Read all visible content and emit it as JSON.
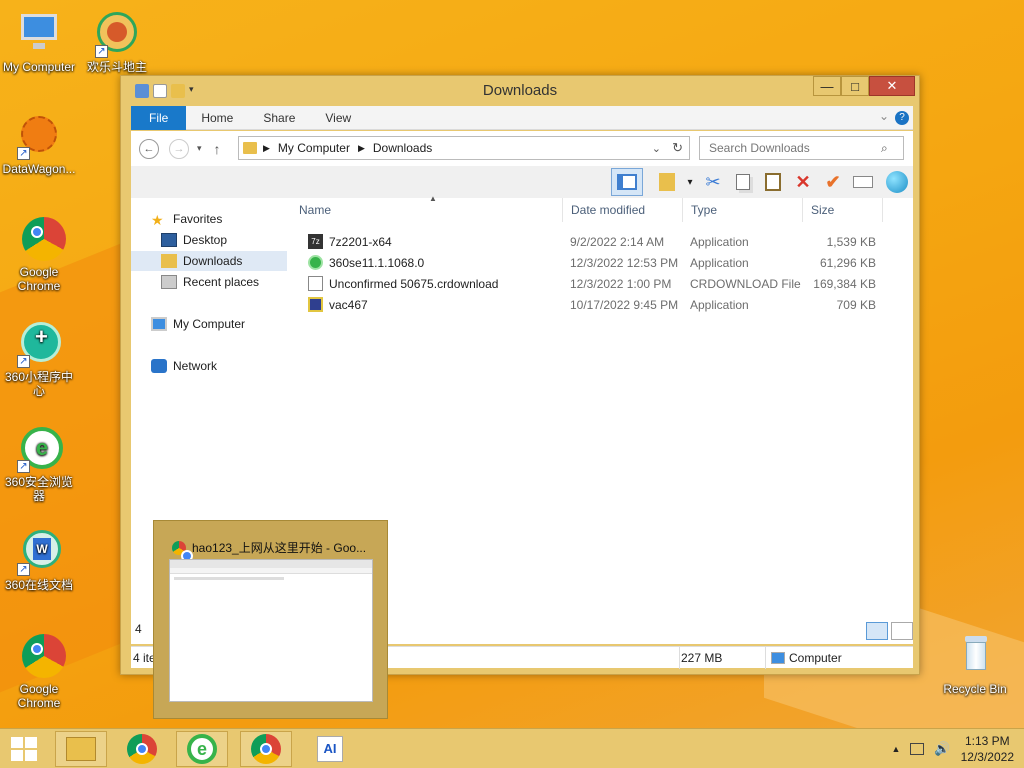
{
  "desktop": {
    "icons": [
      {
        "label": "My Computer"
      },
      {
        "label": "欢乐斗地主"
      },
      {
        "label": "DataWagon..."
      },
      {
        "label": "Google Chrome"
      },
      {
        "label": "360小程序中心"
      },
      {
        "label": "360安全浏览器"
      },
      {
        "label": "360在线文档"
      },
      {
        "label": "Google Chrome"
      },
      {
        "label": "Recycle Bin"
      }
    ]
  },
  "window": {
    "title": "Downloads",
    "controls": {
      "minimize": "—",
      "maximize": "□",
      "close": "✕"
    },
    "ribbon": {
      "tabs": [
        "File",
        "Home",
        "Share",
        "View"
      ],
      "help": "?"
    },
    "address": {
      "path": [
        "My Computer",
        "Downloads"
      ]
    },
    "search": {
      "placeholder": "Search Downloads"
    },
    "nav": {
      "favorites": "Favorites",
      "desktop": "Desktop",
      "downloads": "Downloads",
      "recent": "Recent places",
      "computer": "My Computer",
      "network": "Network"
    },
    "columns": {
      "name": "Name",
      "date": "Date modified",
      "type": "Type",
      "size": "Size"
    },
    "files": [
      {
        "name": "7z2201-x64",
        "date": "9/2/2022 2:14 AM",
        "type": "Application",
        "size": "1,539 KB"
      },
      {
        "name": "360se11.1.1068.0",
        "date": "12/3/2022 12:53 PM",
        "type": "Application",
        "size": "61,296 KB"
      },
      {
        "name": "Unconfirmed 50675.crdownload",
        "date": "12/3/2022 1:00 PM",
        "type": "CRDOWNLOAD File",
        "size": "169,384 KB"
      },
      {
        "name": "vac467",
        "date": "10/17/2022 9:45 PM",
        "type": "Application",
        "size": "709 KB"
      }
    ],
    "count_short": "4",
    "status": {
      "items": "4 ite",
      "size": "227 MB",
      "location": "Computer"
    }
  },
  "thumbnail": {
    "title": "hao123_上网从这里开始 - Goo..."
  },
  "taskbar": {
    "time": "1:13 PM",
    "date": "12/3/2022"
  }
}
